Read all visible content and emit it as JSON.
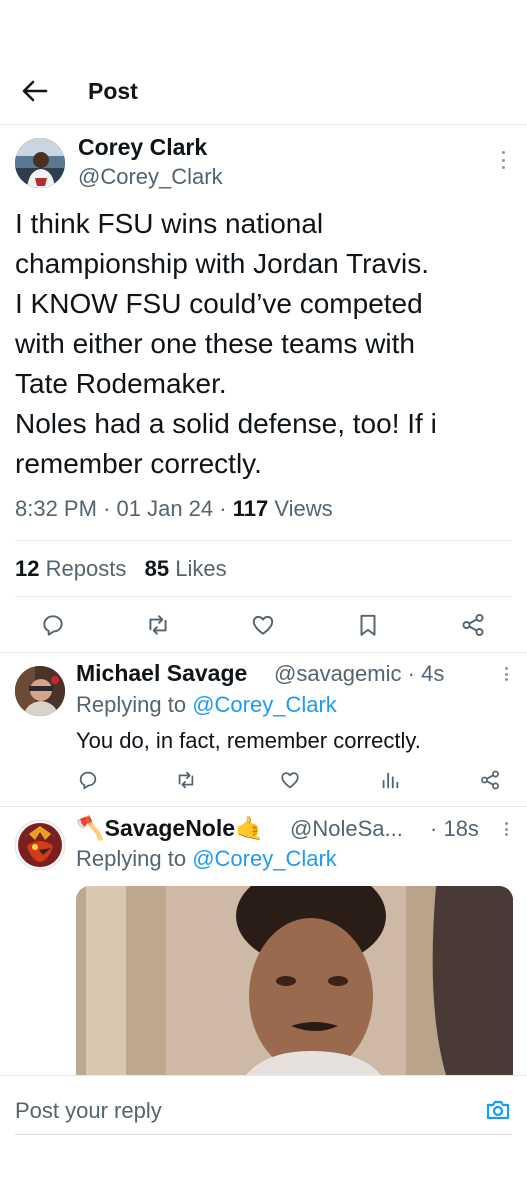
{
  "header": {
    "title": "Post"
  },
  "main_post": {
    "author_name": "Corey Clark",
    "author_handle": "@Corey_Clark",
    "text_lines": [
      "I think FSU wins national",
      "championship with Jordan Travis.",
      "I KNOW FSU could’ve competed",
      "with either one these teams with",
      "Tate Rodemaker.",
      "Noles had a solid defense, too! If i",
      "remember correctly."
    ],
    "time": "8:32 PM",
    "date": "01 Jan 24",
    "views_count": "117",
    "views_label": "Views",
    "reposts_count": "12",
    "reposts_label": "Reposts",
    "likes_count": "85",
    "likes_label": "Likes",
    "separator": "·"
  },
  "replies": [
    {
      "author_name": "Michael Savage",
      "author_handle": "@savagemic",
      "time": "4s",
      "replying_to_label": "Replying to",
      "replying_to_handle": "@Corey_Clark",
      "text": "You do, in fact, remember correctly."
    },
    {
      "author_name": "SavageNole",
      "name_prefix_emoji": "🪓",
      "name_suffix_emoji": "🤙",
      "author_handle": "@NoleSa...",
      "time": "18s",
      "replying_to_label": "Replying to",
      "replying_to_handle": "@Corey_Clark"
    }
  ],
  "composer": {
    "placeholder": "Post your reply"
  },
  "colors": {
    "accent": "#1d9bf0",
    "text": "#0f1419",
    "muted": "#536471",
    "divider": "#e6e9ec"
  },
  "icons": [
    "back-arrow-icon",
    "more-icon",
    "reply-icon",
    "repost-icon",
    "like-icon",
    "bookmark-icon",
    "share-icon",
    "analytics-icon",
    "camera-icon"
  ]
}
